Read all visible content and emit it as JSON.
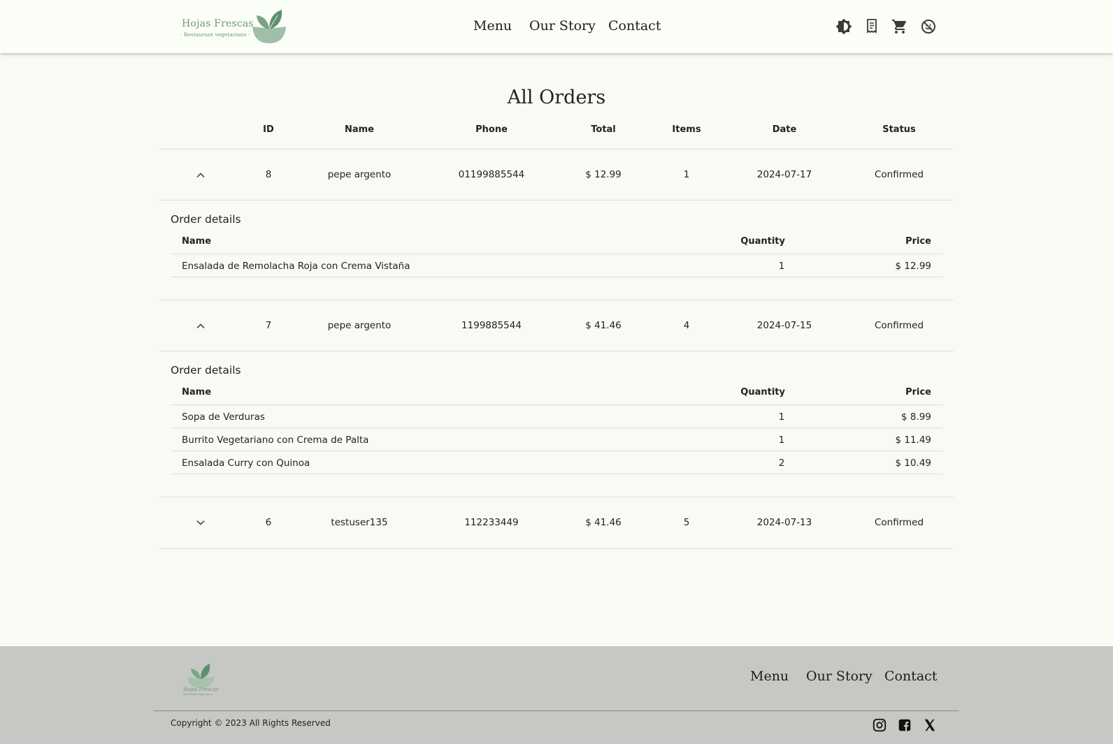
{
  "brand": {
    "name": "Hojas Frescas",
    "tagline": "- Restaurant vegetariano -",
    "footer_name": "Hojas Frescas",
    "footer_tagline": "Restaurant vegetariano",
    "color": "#6e9a79"
  },
  "header": {
    "nav": [
      "Menu",
      "Our Story",
      "Contact"
    ],
    "icons": [
      "theme-toggle-icon",
      "receipt-icon",
      "cart-icon",
      "logout-icon"
    ]
  },
  "page": {
    "title": "All Orders"
  },
  "orders_table": {
    "columns": [
      "ID",
      "Name",
      "Phone",
      "Total",
      "Items",
      "Date",
      "Status"
    ],
    "rows": [
      {
        "id": "8",
        "name": "pepe argento",
        "phone": "01199885544",
        "total": "$ 12.99",
        "items": "1",
        "date": "2024-07-17",
        "status": "Confirmed",
        "expanded": true
      },
      {
        "id": "7",
        "name": "pepe argento",
        "phone": "1199885544",
        "total": "$ 41.46",
        "items": "4",
        "date": "2024-07-15",
        "status": "Confirmed",
        "expanded": true
      },
      {
        "id": "6",
        "name": "testuser135",
        "phone": "112233449",
        "total": "$ 41.46",
        "items": "5",
        "date": "2024-07-13",
        "status": "Confirmed",
        "expanded": false
      }
    ]
  },
  "details": {
    "title": "Order details",
    "columns": [
      "Name",
      "Quantity",
      "Price"
    ],
    "order_8": [
      {
        "name": "Ensalada de Remolacha Roja con Crema Vistaña",
        "quantity": "1",
        "price": "$ 12.99"
      }
    ],
    "order_7": [
      {
        "name": "Sopa de Verduras",
        "quantity": "1",
        "price": "$ 8.99"
      },
      {
        "name": "Burrito Vegetariano con Crema de Palta",
        "quantity": "1",
        "price": "$ 11.49"
      },
      {
        "name": "Ensalada Curry con Quinoa",
        "quantity": "2",
        "price": "$ 10.49"
      }
    ]
  },
  "footer": {
    "nav": [
      "Menu",
      "Our Story",
      "Contact"
    ],
    "copyright": "Copyright © 2023 All Rights Reserved",
    "social": [
      "instagram-icon",
      "facebook-icon",
      "x-icon"
    ]
  },
  "colors": {
    "page_bg": "#f8fbf3",
    "header_bg": "#fbfdf7",
    "footer_bg": "#c7c8c3",
    "divider": "#dcdfd8"
  }
}
